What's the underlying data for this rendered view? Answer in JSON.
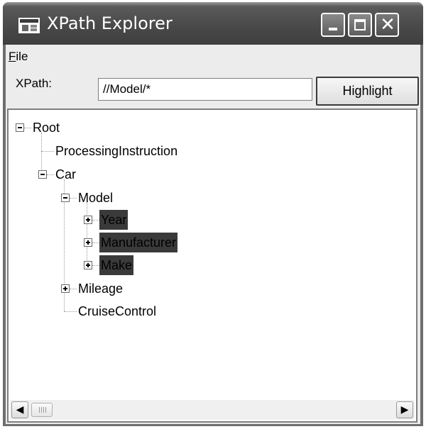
{
  "window": {
    "title": "XPath Explorer",
    "icon": "app-window-icon"
  },
  "caption_buttons": {
    "minimize_icon": "minimize-icon",
    "maximize_icon": "maximize-icon",
    "close_icon": "close-icon",
    "close_glyph": "✕"
  },
  "menu": {
    "file_label_underlined": "F",
    "file_label_rest": "ile"
  },
  "toolbar": {
    "xpath_label": "XPath:",
    "xpath_value": "//Model/*",
    "highlight_label": "Highlight"
  },
  "tree": {
    "root": "Root",
    "processing_instruction": "ProcessingInstruction",
    "car": "Car",
    "model": "Model",
    "year": "Year",
    "manufacturer": "Manufacturer",
    "make": "Make",
    "mileage": "Mileage",
    "cruise_control": "CruiseControl"
  },
  "scrollbar": {
    "left_glyph": "◀",
    "right_glyph": "▶"
  }
}
